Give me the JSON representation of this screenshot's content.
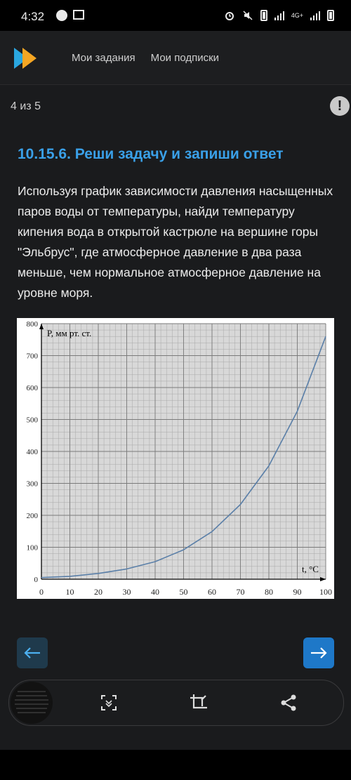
{
  "status_bar": {
    "time": "4:32",
    "network": "4G+"
  },
  "app_nav": {
    "tabs": [
      "Мои задания",
      "Мои подписки"
    ]
  },
  "progress": {
    "label": "4 из 5",
    "alert": "!"
  },
  "task": {
    "title": "10.15.6. Реши задачу и запиши ответ",
    "text": "Используя график зависимости давления насыщенных паров воды от температуры, найди температуру кипения вода в открытой кастрюле на вершине горы \"Эльбрус\", где атмосферное давление в два раза меньше, чем нормальное атмосферное давление на уровне моря."
  },
  "chart_data": {
    "type": "line",
    "ylabel": "P, мм рт. ст.",
    "xlabel": "t, °C",
    "xlim": [
      0,
      100
    ],
    "ylim": [
      0,
      800
    ],
    "x_ticks": [
      0,
      10,
      20,
      30,
      40,
      50,
      60,
      70,
      80,
      90,
      100
    ],
    "y_ticks": [
      0,
      100,
      200,
      300,
      400,
      500,
      600,
      700,
      800
    ],
    "grid": true,
    "series": [
      {
        "x": [
          0,
          10,
          20,
          30,
          40,
          50,
          60,
          70,
          80,
          90,
          100
        ],
        "y": [
          5,
          9,
          18,
          32,
          55,
          92,
          149,
          234,
          355,
          526,
          760
        ],
        "color": "#5a7fa8"
      }
    ]
  },
  "bottom_bar": {
    "icons": [
      "scan-icon",
      "crop-edit-icon",
      "share-icon"
    ]
  },
  "colors": {
    "accent": "#3aa0e8",
    "next_button": "#1e78c8",
    "prev_button": "#1f3a4c"
  }
}
